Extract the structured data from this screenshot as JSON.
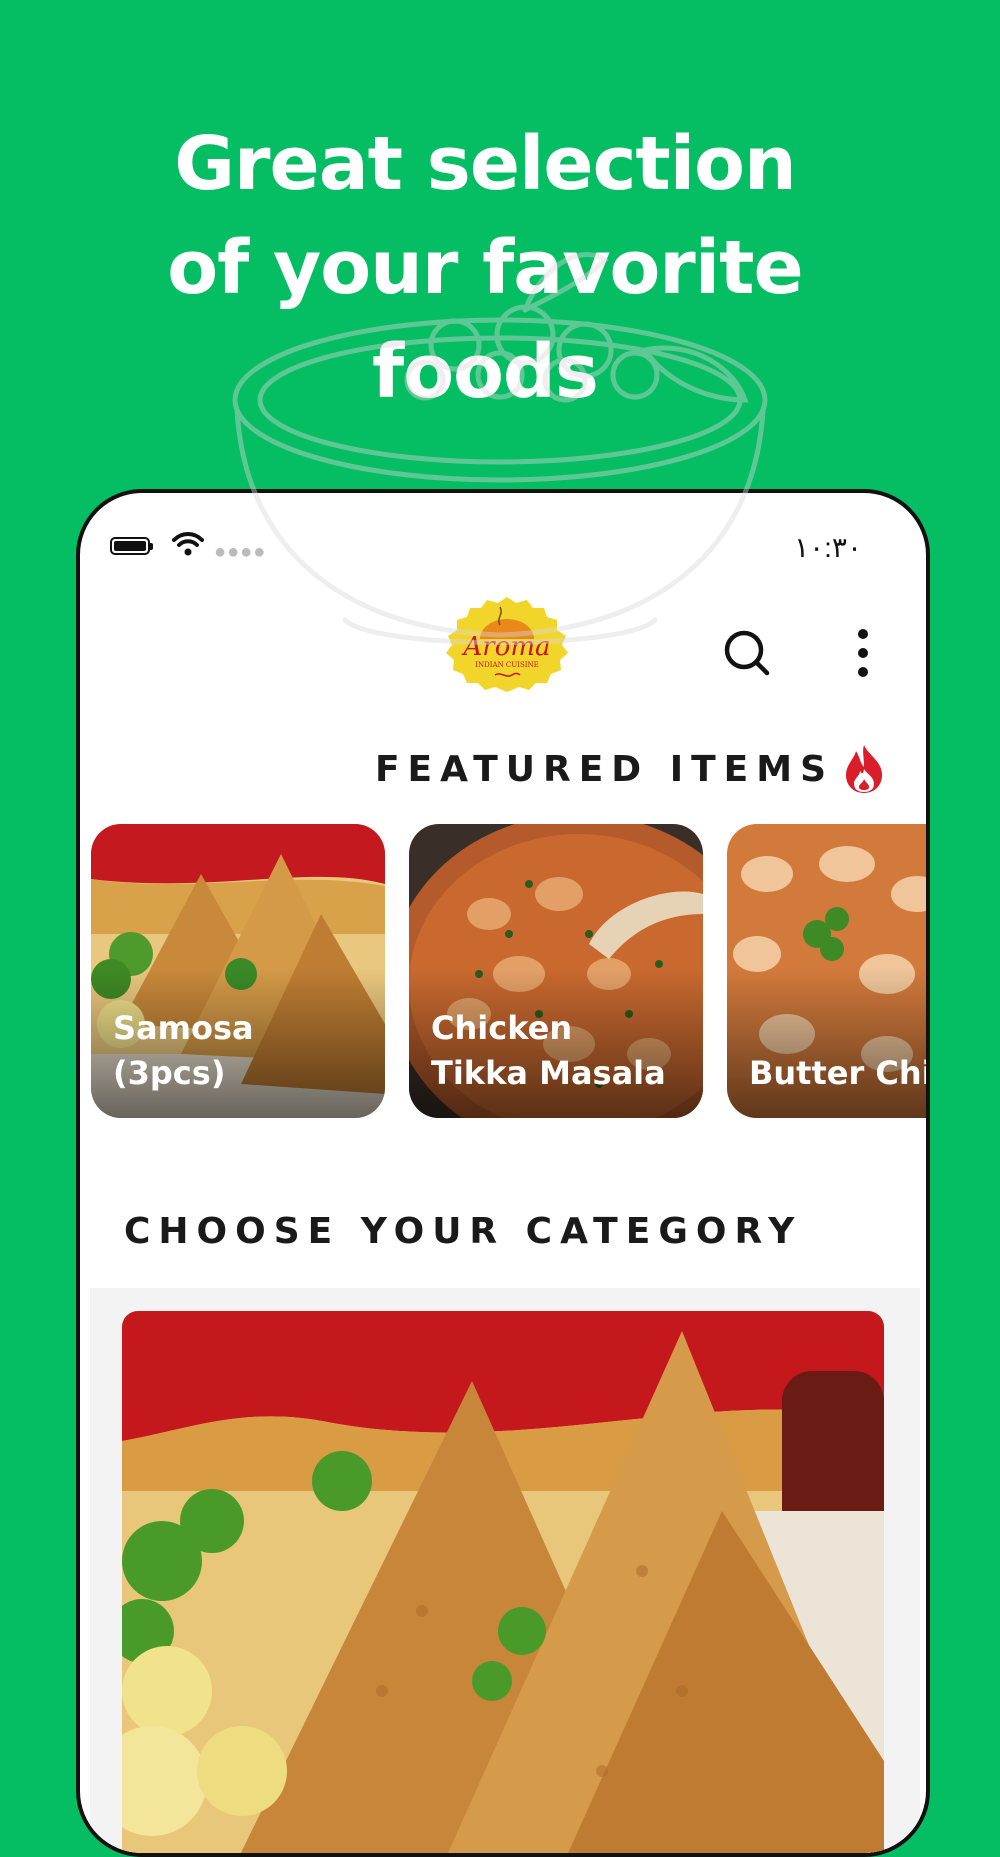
{
  "headline": {
    "line1": "Great selection",
    "line2": "of your favorite",
    "line3": "foods"
  },
  "status_bar": {
    "time": "١٠:٣٠"
  },
  "header": {
    "logo_text": "Aroma",
    "logo_subtext": "INDIAN CUISINE"
  },
  "featured": {
    "title": "FEATURED ITEMS",
    "items": [
      {
        "label": "Samosa (3pcs)"
      },
      {
        "label": "Chicken\nTikka Masala"
      },
      {
        "label": "Butter Chic"
      }
    ]
  },
  "category": {
    "title": "CHOOSE YOUR CATEGORY"
  },
  "colors": {
    "brand_green": "#05bd63",
    "logo_yellow": "#f2d52a",
    "logo_red": "#c8141e",
    "fire_red": "#d91e2a"
  },
  "icons": {
    "search": "search-icon",
    "more": "more-vertical-icon",
    "fire": "fire-icon",
    "wifi": "wifi-icon",
    "battery": "battery-icon"
  }
}
